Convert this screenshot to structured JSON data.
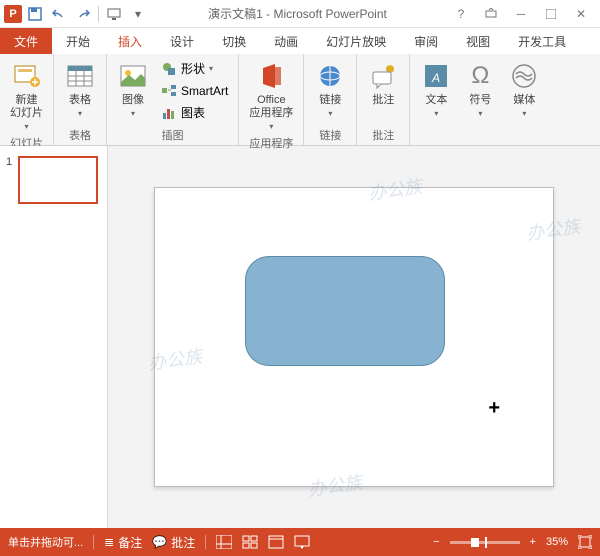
{
  "app": {
    "title": "演示文稿1 - Microsoft PowerPoint"
  },
  "tabs": {
    "file": "文件",
    "home": "开始",
    "insert": "插入",
    "design": "设计",
    "transitions": "切换",
    "animations": "动画",
    "slideshow": "幻灯片放映",
    "review": "审阅",
    "view": "视图",
    "developer": "开发工具"
  },
  "ribbon": {
    "new_slide": "新建\n幻灯片",
    "table": "表格",
    "images": "图像",
    "shapes": "形状",
    "smartart": "SmartArt",
    "chart": "图表",
    "office_apps": "Office\n应用程序",
    "links": "链接",
    "comment": "批注",
    "text": "文本",
    "symbols": "符号",
    "media": "媒体",
    "groups": {
      "slides": "幻灯片",
      "tables": "表格",
      "illustrations": "插图",
      "apps": "应用程序",
      "links": "链接",
      "comments": "批注"
    }
  },
  "thumbnail": {
    "num": "1"
  },
  "status": {
    "hint": "单击并拖动可...",
    "notes": "备注",
    "comments": "批注",
    "zoom": "35%"
  }
}
